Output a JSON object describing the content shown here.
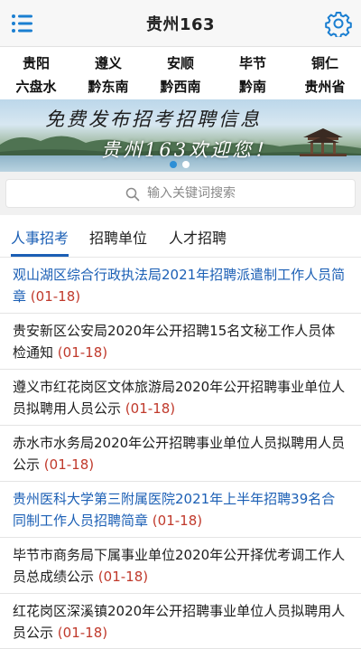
{
  "header": {
    "title": "贵州163",
    "menu_icon": "menu-icon",
    "settings_icon": "gear-icon",
    "accent": "#1b7fd1"
  },
  "cities": [
    {
      "label": "贵阳"
    },
    {
      "label": "遵义"
    },
    {
      "label": "安顺"
    },
    {
      "label": "毕节"
    },
    {
      "label": "铜仁"
    },
    {
      "label": "六盘水"
    },
    {
      "label": "黔东南"
    },
    {
      "label": "黔西南"
    },
    {
      "label": "黔南"
    },
    {
      "label": "贵州省"
    }
  ],
  "banner": {
    "line1": "免费发布招考招聘信息",
    "line2": "贵州163欢迎您！",
    "slide_count": 2,
    "active_slide": 1
  },
  "search": {
    "placeholder": "输入关键词搜索",
    "value": ""
  },
  "tabs": [
    {
      "label": "人事招考",
      "active": true
    },
    {
      "label": "招聘单位",
      "active": false
    },
    {
      "label": "人才招聘",
      "active": false
    }
  ],
  "news": [
    {
      "title": "观山湖区综合行政执法局2021年招聘派遣制工作人员简章",
      "date": "01-18",
      "highlight": true
    },
    {
      "title": "贵安新区公安局2020年公开招聘15名文秘工作人员体检通知",
      "date": "01-18",
      "highlight": false
    },
    {
      "title": "遵义市红花岗区文体旅游局2020年公开招聘事业单位人员拟聘用人员公示",
      "date": "01-18",
      "highlight": false
    },
    {
      "title": "赤水市水务局2020年公开招聘事业单位人员拟聘用人员公示",
      "date": "01-18",
      "highlight": false
    },
    {
      "title": "贵州医科大学第三附属医院2021年上半年招聘39名合同制工作人员招聘简章",
      "date": "01-18",
      "highlight": true
    },
    {
      "title": "毕节市商务局下属事业单位2020年公开择优考调工作人员总成绩公示",
      "date": "01-18",
      "highlight": false
    },
    {
      "title": "红花岗区深溪镇2020年公开招聘事业单位人员拟聘用人员公示",
      "date": "01-18",
      "highlight": false
    }
  ],
  "colors": {
    "link_blue": "#1b5fb5",
    "date_red": "#c0392b",
    "dot_active": "#ffffff",
    "dot_inactive": "#2d8fd6"
  }
}
